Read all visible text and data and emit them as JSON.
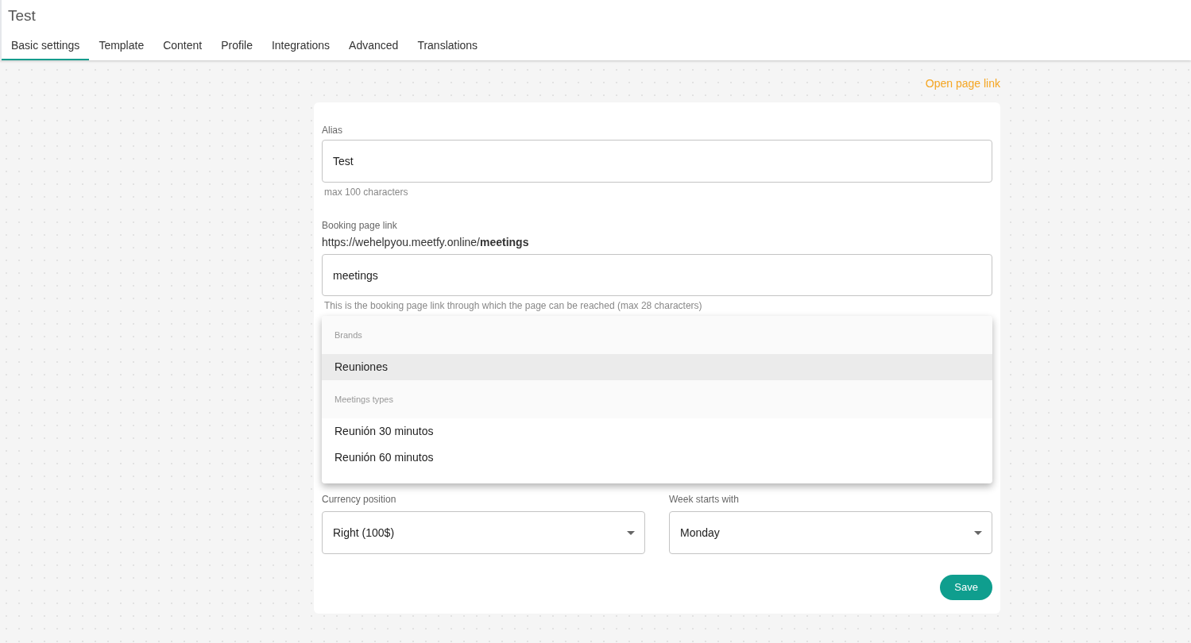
{
  "page_title": "Test",
  "tabs": [
    {
      "label": "Basic settings",
      "selected": true
    },
    {
      "label": "Template",
      "selected": false
    },
    {
      "label": "Content",
      "selected": false
    },
    {
      "label": "Profile",
      "selected": false
    },
    {
      "label": "Integrations",
      "selected": false
    },
    {
      "label": "Advanced",
      "selected": false
    },
    {
      "label": "Translations",
      "selected": false
    }
  ],
  "open_page_link": "Open page link",
  "alias": {
    "label": "Alias",
    "value": "Test",
    "helper": "max 100 characters"
  },
  "booking_link": {
    "label": "Booking page link",
    "url": "https://wehelpyou.meetfy.online/**meetings**",
    "value": "meetings",
    "helper": "This is the booking page link through which the page can be reached (max 28 characters)"
  },
  "dropdown_menu": [
    {
      "kind": "group",
      "label": "Brands"
    },
    {
      "kind": "option",
      "label": "Reuniones",
      "selected": true
    },
    {
      "kind": "group",
      "label": "Meetings types"
    },
    {
      "kind": "option",
      "label": "Reunión 30 minutos",
      "selected": false
    },
    {
      "kind": "option",
      "label": "Reunión 60 minutos",
      "selected": false
    }
  ],
  "currency_position": {
    "label": "Currency position",
    "value": "Right (100$)"
  },
  "week_starts_with": {
    "label": "Week starts with",
    "value": "Monday"
  },
  "save_button": "Save"
}
